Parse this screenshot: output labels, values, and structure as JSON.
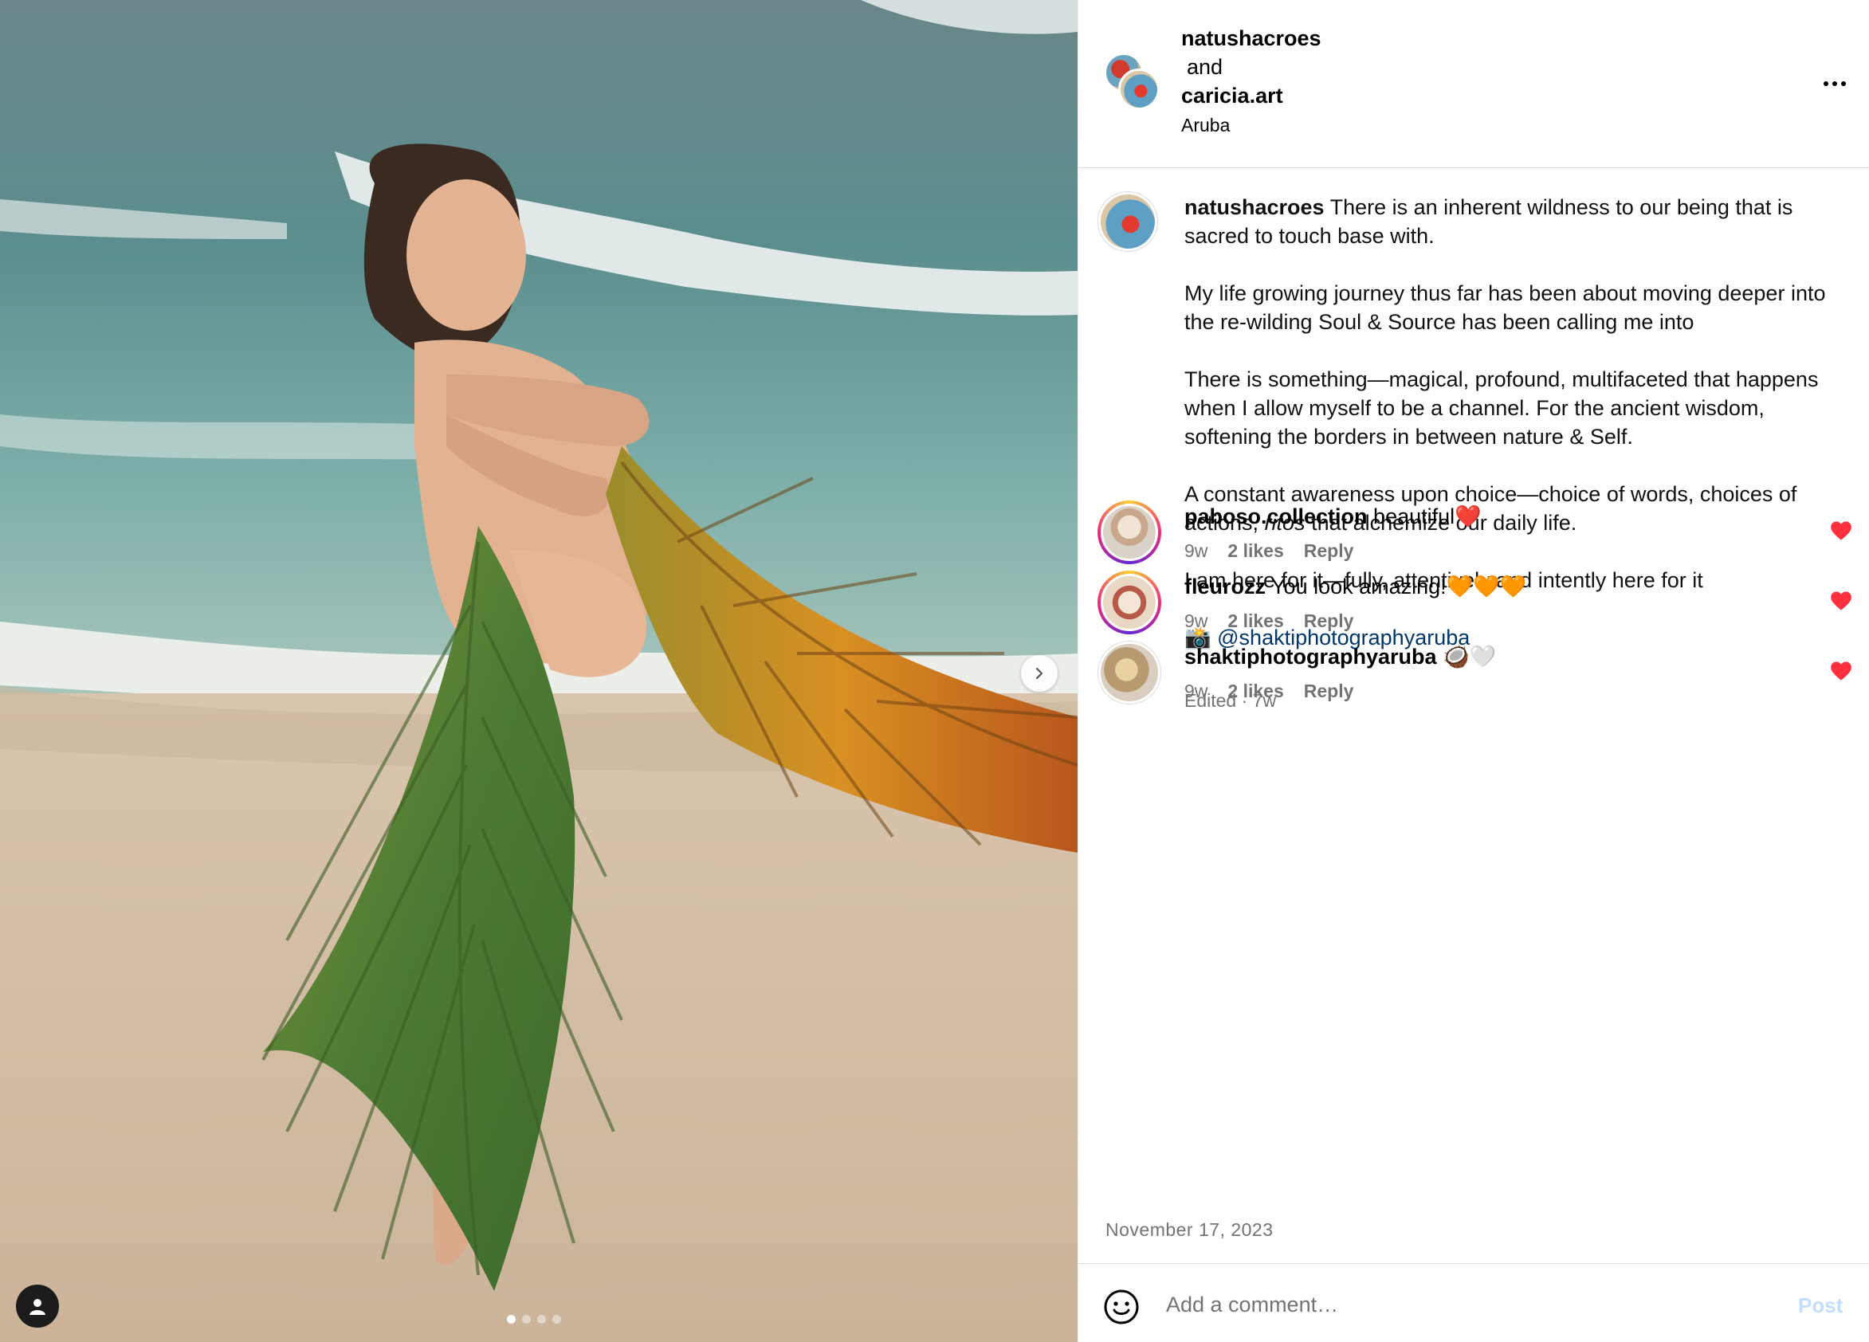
{
  "post": {
    "author_primary": "natushacroes",
    "collab_joiner": "and",
    "author_secondary": "caricia.art",
    "location": "Aruba",
    "more_icon": "more-horizontal-icon"
  },
  "caption": {
    "username": "natushacroes",
    "paragraphs": [
      "There is an inherent wildness to our being that is sacred to touch base with.",
      "My life growing journey thus far has been about moving deeper into the re-wilding Soul & Source has been calling me into",
      "There is something—magical, profound, multifaceted that happens when I allow myself to be a channel. For the ancient wisdom, softening the borders in between nature & Self."
    ],
    "p4_before": "A constant awareness upon choice—choice of words, choices of actions, ",
    "p4_italic": "ritos",
    "p4_after": " that alchemize our daily life.",
    "p5": "I am here for it—fully, attentively and intently here for it",
    "camera_emoji": "📸",
    "mention": "@shaktiphotographyaruba",
    "meta": "Edited · 7w"
  },
  "comments": [
    {
      "username": "paboso.collection",
      "text": "beautiful❤️",
      "age": "9w",
      "likes": "2 likes",
      "reply": "Reply",
      "liked": true
    },
    {
      "username": "fleurozz",
      "text": "You look amazing!🧡🧡🧡",
      "age": "9w",
      "likes": "2 likes",
      "reply": "Reply",
      "liked": true
    },
    {
      "username": "shaktiphotographyaruba",
      "text": "🥥🤍",
      "age": "9w",
      "likes": "2 likes",
      "reply": "Reply",
      "liked": true
    }
  ],
  "date": "November 17, 2023",
  "composer": {
    "placeholder": "Add a comment…",
    "post_label": "Post"
  },
  "carousel": {
    "current": 1,
    "total": 4
  },
  "colors": {
    "heart": "#ff3040",
    "mention": "#00376b",
    "muted": "#737373",
    "post_disabled": "#c0dffd"
  }
}
